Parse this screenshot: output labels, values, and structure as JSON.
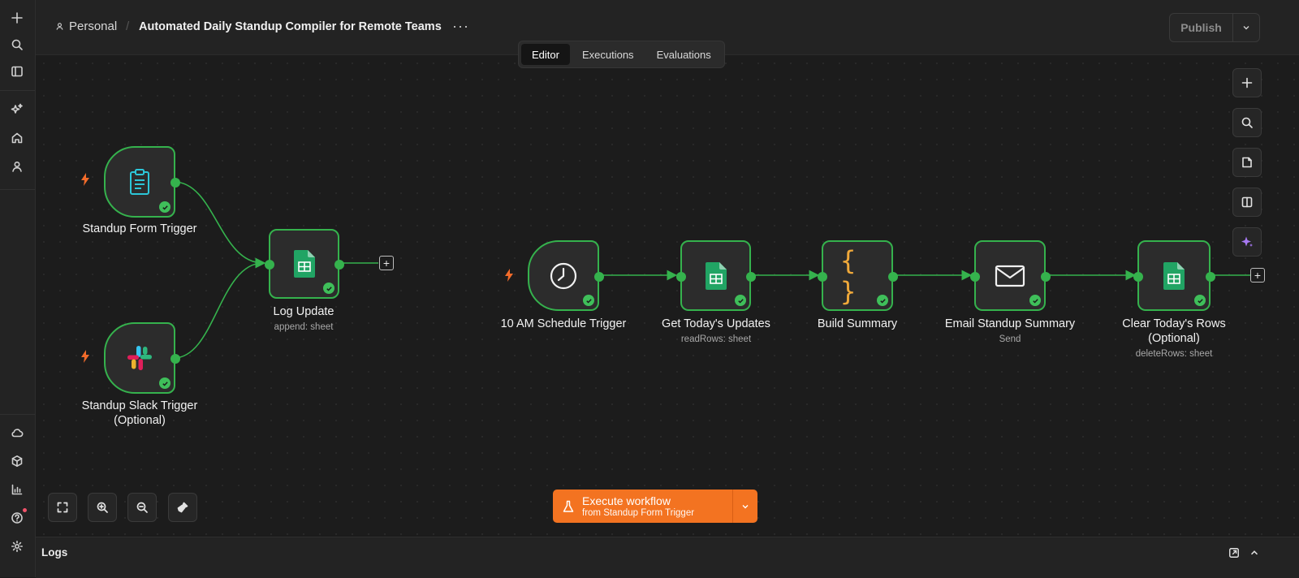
{
  "header": {
    "breadcrumb_owner": "Personal",
    "workflow_title": "Automated Daily Standup Compiler for Remote Teams",
    "more_label": "···",
    "publish_label": "Publish"
  },
  "tabs": [
    {
      "label": "Editor",
      "active": true
    },
    {
      "label": "Executions",
      "active": false
    },
    {
      "label": "Evaluations",
      "active": false
    }
  ],
  "nodes": {
    "form_trigger": {
      "label": "Standup Form Trigger",
      "sub": ""
    },
    "slack_trigger": {
      "label": "Standup Slack Trigger (Optional)",
      "line1": "Standup Slack Trigger",
      "line2": "(Optional)"
    },
    "log_update": {
      "label": "Log Update",
      "sub": "append: sheet"
    },
    "schedule_trigger": {
      "label": "10 AM Schedule Trigger"
    },
    "get_updates": {
      "label": "Get Today's Updates",
      "sub": "readRows: sheet"
    },
    "build_summary": {
      "label": "Build Summary"
    },
    "email_summary": {
      "label": "Email Standup Summary",
      "sub": "Send"
    },
    "clear_rows": {
      "label": "Clear Today's Rows (Optional)",
      "line1": "Clear Today's Rows",
      "line2": "(Optional)",
      "sub": "deleteRows: sheet"
    }
  },
  "execute": {
    "title": "Execute workflow",
    "subtitle": "from Standup Form Trigger"
  },
  "logs": {
    "label": "Logs"
  },
  "colors": {
    "node_border": "#35b24d",
    "execute_button": "#f37321",
    "trigger_bolt": "#f26b2a"
  },
  "icons": {
    "rail": [
      "plus-icon",
      "search-icon",
      "sidebar-icon",
      "sparkles-icon",
      "home-icon",
      "user-icon",
      "cloud-icon",
      "package-icon",
      "chart-icon",
      "help-icon",
      "settings-icon"
    ],
    "right_toolbar": [
      "plus-icon",
      "search-icon",
      "sticky-note-icon",
      "panel-icon",
      "ai-sparkle-icon"
    ],
    "zoom": [
      "fit-view-icon",
      "zoom-in-icon",
      "zoom-out-icon",
      "tidy-up-icon"
    ]
  }
}
